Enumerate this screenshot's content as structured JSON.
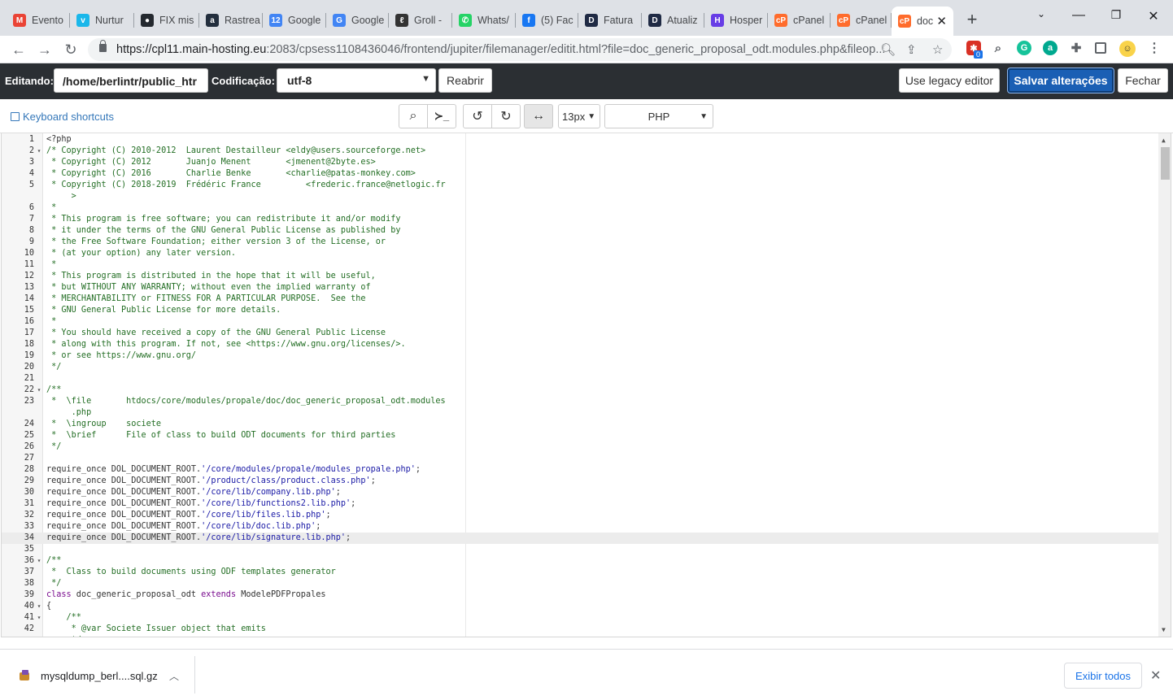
{
  "browser": {
    "tabs": [
      {
        "title": "Evento",
        "icon": "gmail-icon",
        "color": "#ea4335",
        "glyph": "M"
      },
      {
        "title": "Nurtur",
        "icon": "vimeo-icon",
        "color": "#1ab7ea",
        "glyph": "v"
      },
      {
        "title": "FIX mis",
        "icon": "github-icon",
        "color": "#24292f",
        "glyph": "●"
      },
      {
        "title": "Rastrea",
        "icon": "amazon-icon",
        "color": "#232f3e",
        "glyph": "a"
      },
      {
        "title": "Google",
        "icon": "google-calendar-icon",
        "color": "#4285f4",
        "glyph": "12"
      },
      {
        "title": "Google",
        "icon": "google-translate-icon",
        "color": "#4285f4",
        "glyph": "G"
      },
      {
        "title": "Groll -",
        "icon": "groll-icon",
        "color": "#333333",
        "glyph": "ℓ"
      },
      {
        "title": "Whats/",
        "icon": "whatsapp-icon",
        "color": "#25d366",
        "glyph": "✆"
      },
      {
        "title": "(5) Fac",
        "icon": "facebook-icon",
        "color": "#1877f2",
        "glyph": "f"
      },
      {
        "title": "Fatura",
        "icon": "d-app-icon",
        "color": "#1f2a44",
        "glyph": "D"
      },
      {
        "title": "Atualiz",
        "icon": "d-app-icon",
        "color": "#1f2a44",
        "glyph": "D"
      },
      {
        "title": "Hosper",
        "icon": "hostinger-icon",
        "color": "#673de6",
        "glyph": "H"
      },
      {
        "title": "cPanel",
        "icon": "cpanel-icon",
        "color": "#ff6c2c",
        "glyph": "cP"
      },
      {
        "title": "cPanel",
        "icon": "cpanel-icon",
        "color": "#ff6c2c",
        "glyph": "cP"
      },
      {
        "title": "doc",
        "icon": "cpanel-icon",
        "color": "#ff6c2c",
        "glyph": "cP",
        "active": true
      }
    ],
    "new_tab": "+",
    "url_host": "https://cpl11.main-hosting.eu",
    "url_rest": ":2083/cpsess1108436046/frontend/jupiter/filemanager/editit.html?file=doc_generic_proposal_odt.modules.php&fileop...",
    "extension_badge": "0"
  },
  "cpanel": {
    "editing_label": "Editando:",
    "path_value": "/home/berlintr/public_htr",
    "encoding_label": "Codificação:",
    "encoding_value": "utf-8",
    "reopen_button": "Reabrir",
    "legacy_button": "Use legacy editor",
    "save_button": "Salvar alterações",
    "close_button": "Fechar",
    "keyboard_shortcuts": "Keyboard shortcuts",
    "font_size": "13px",
    "mode": "PHP"
  },
  "editor": {
    "active_line": 34,
    "lines": [
      {
        "n": "1",
        "fold": "",
        "t": "<?php",
        "c": "php"
      },
      {
        "n": "2",
        "fold": "▾",
        "t": "/* Copyright (C) 2010-2012  Laurent Destailleur <eldy@users.sourceforge.net>",
        "c": "com"
      },
      {
        "n": "3",
        "fold": "",
        "t": " * Copyright (C) 2012       Juanjo Menent       <jmenent@2byte.es>",
        "c": "com"
      },
      {
        "n": "4",
        "fold": "",
        "t": " * Copyright (C) 2016       Charlie Benke       <charlie@patas-monkey.com>",
        "c": "com"
      },
      {
        "n": "5",
        "fold": "",
        "t": " * Copyright (C) 2018-2019  Frédéric France         <frederic.france@netlogic.fr",
        "c": "com"
      },
      {
        "n": "",
        "fold": "",
        "t": "     >",
        "c": "com"
      },
      {
        "n": "6",
        "fold": "",
        "t": " *",
        "c": "com"
      },
      {
        "n": "7",
        "fold": "",
        "t": " * This program is free software; you can redistribute it and/or modify",
        "c": "com"
      },
      {
        "n": "8",
        "fold": "",
        "t": " * it under the terms of the GNU General Public License as published by",
        "c": "com"
      },
      {
        "n": "9",
        "fold": "",
        "t": " * the Free Software Foundation; either version 3 of the License, or",
        "c": "com"
      },
      {
        "n": "10",
        "fold": "",
        "t": " * (at your option) any later version.",
        "c": "com"
      },
      {
        "n": "11",
        "fold": "",
        "t": " *",
        "c": "com"
      },
      {
        "n": "12",
        "fold": "",
        "t": " * This program is distributed in the hope that it will be useful,",
        "c": "com"
      },
      {
        "n": "13",
        "fold": "",
        "t": " * but WITHOUT ANY WARRANTY; without even the implied warranty of",
        "c": "com"
      },
      {
        "n": "14",
        "fold": "",
        "t": " * MERCHANTABILITY or FITNESS FOR A PARTICULAR PURPOSE.  See the",
        "c": "com"
      },
      {
        "n": "15",
        "fold": "",
        "t": " * GNU General Public License for more details.",
        "c": "com"
      },
      {
        "n": "16",
        "fold": "",
        "t": " *",
        "c": "com"
      },
      {
        "n": "17",
        "fold": "",
        "t": " * You should have received a copy of the GNU General Public License",
        "c": "com"
      },
      {
        "n": "18",
        "fold": "",
        "t": " * along with this program. If not, see <https://www.gnu.org/licenses/>.",
        "c": "com"
      },
      {
        "n": "19",
        "fold": "",
        "t": " * or see https://www.gnu.org/",
        "c": "com"
      },
      {
        "n": "20",
        "fold": "",
        "t": " */",
        "c": "com"
      },
      {
        "n": "21",
        "fold": "",
        "t": "",
        "c": "php"
      },
      {
        "n": "22",
        "fold": "▾",
        "t": "/**",
        "c": "com"
      },
      {
        "n": "23",
        "fold": "",
        "t": " *  \\file       htdocs/core/modules/propale/doc/doc_generic_proposal_odt.modules",
        "c": "com"
      },
      {
        "n": "",
        "fold": "",
        "t": "     .php",
        "c": "com"
      },
      {
        "n": "24",
        "fold": "",
        "t": " *  \\ingroup    societe",
        "c": "com"
      },
      {
        "n": "25",
        "fold": "",
        "t": " *  \\brief      File of class to build ODT documents for third parties",
        "c": "com"
      },
      {
        "n": "26",
        "fold": "",
        "t": " */",
        "c": "com"
      },
      {
        "n": "27",
        "fold": "",
        "t": "",
        "c": "php"
      },
      {
        "n": "28",
        "fold": "",
        "pre": "require_once DOL_DOCUMENT_ROOT.",
        "str": "'/core/modules/propale/modules_propale.php'",
        "post": ";",
        "c": "req"
      },
      {
        "n": "29",
        "fold": "",
        "pre": "require_once DOL_DOCUMENT_ROOT.",
        "str": "'/product/class/product.class.php'",
        "post": ";",
        "c": "req"
      },
      {
        "n": "30",
        "fold": "",
        "pre": "require_once DOL_DOCUMENT_ROOT.",
        "str": "'/core/lib/company.lib.php'",
        "post": ";",
        "c": "req"
      },
      {
        "n": "31",
        "fold": "",
        "pre": "require_once DOL_DOCUMENT_ROOT.",
        "str": "'/core/lib/functions2.lib.php'",
        "post": ";",
        "c": "req"
      },
      {
        "n": "32",
        "fold": "",
        "pre": "require_once DOL_DOCUMENT_ROOT.",
        "str": "'/core/lib/files.lib.php'",
        "post": ";",
        "c": "req"
      },
      {
        "n": "33",
        "fold": "",
        "pre": "require_once DOL_DOCUMENT_ROOT.",
        "str": "'/core/lib/doc.lib.php'",
        "post": ";",
        "c": "req"
      },
      {
        "n": "34",
        "fold": "",
        "pre": "require_once DOL_DOCUMENT_ROOT.",
        "str": "'/core/lib/signature.lib.php'",
        "post": ";",
        "c": "req"
      },
      {
        "n": "35",
        "fold": "",
        "t": "",
        "c": "php"
      },
      {
        "n": "36",
        "fold": "▾",
        "t": "/**",
        "c": "com"
      },
      {
        "n": "37",
        "fold": "",
        "t": " *  Class to build documents using ODF templates generator",
        "c": "com"
      },
      {
        "n": "38",
        "fold": "",
        "t": " */",
        "c": "com"
      },
      {
        "n": "39",
        "fold": "",
        "kw1": "class",
        "mid": " doc_generic_proposal_odt ",
        "kw2": "extends",
        "post": " ModelePDFPropales",
        "c": "cls"
      },
      {
        "n": "40",
        "fold": "▾",
        "t": "{",
        "c": "php"
      },
      {
        "n": "41",
        "fold": "▾",
        "t": "    /**",
        "c": "com"
      },
      {
        "n": "42",
        "fold": "",
        "t": "     * @var Societe Issuer object that emits",
        "c": "com"
      },
      {
        "n": "",
        "fold": "",
        "t": "     */",
        "c": "com"
      }
    ]
  },
  "downloads": {
    "file_name": "mysqldump_berl....sql.gz",
    "show_all": "Exibir todos"
  }
}
